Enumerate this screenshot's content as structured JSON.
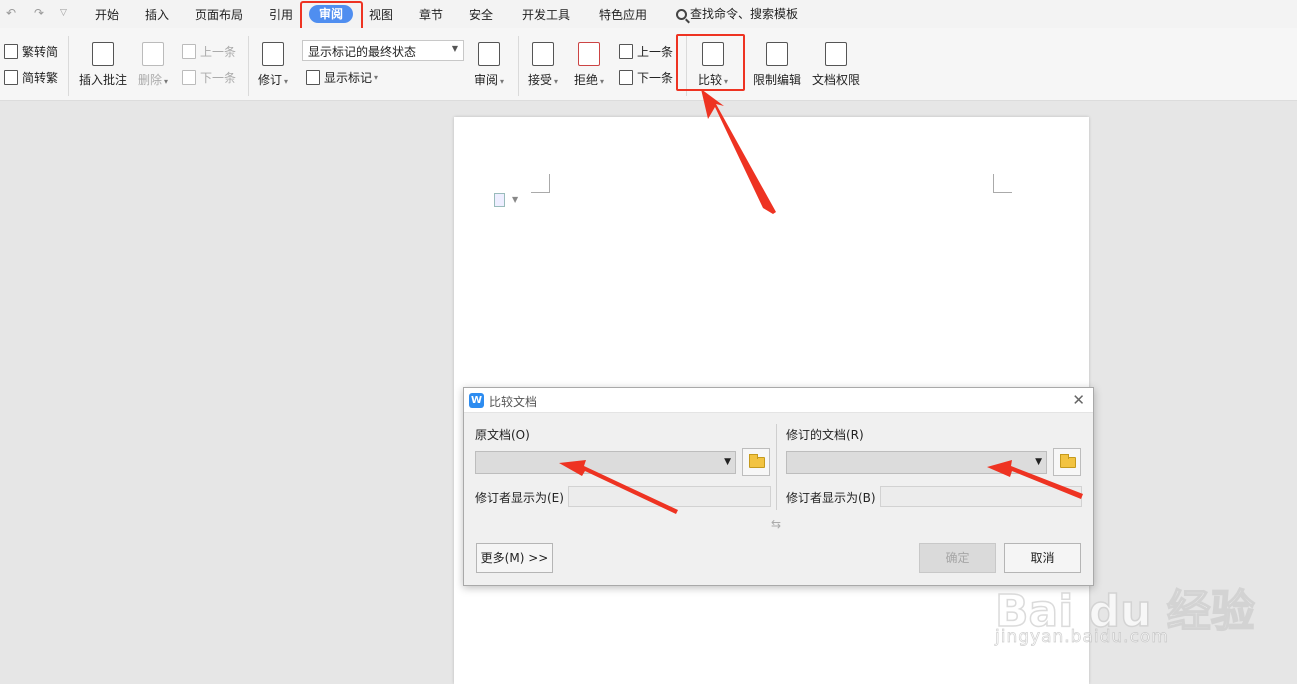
{
  "menubar": {
    "items": [
      {
        "label": "开始"
      },
      {
        "label": "插入"
      },
      {
        "label": "页面布局"
      },
      {
        "label": "引用"
      },
      {
        "label": "审阅",
        "active": true
      },
      {
        "label": "视图"
      },
      {
        "label": "章节"
      },
      {
        "label": "安全"
      },
      {
        "label": "开发工具"
      },
      {
        "label": "特色应用"
      }
    ],
    "search_label": "查找命令、搜索模板"
  },
  "ribbon": {
    "trad_to_simp": "繁转简",
    "simp_to_trad": "简转繁",
    "insert_comment": "插入批注",
    "delete": "删除",
    "prev_comment": "上一条",
    "next_comment": "下一条",
    "revise": "修订",
    "markup_mode": "显示标记的最终状态",
    "show_markup": "显示标记",
    "review": "审阅",
    "accept": "接受",
    "reject": "拒绝",
    "prev_change": "上一条",
    "next_change": "下一条",
    "compare": "比较",
    "restrict_edit": "限制编辑",
    "doc_rights": "文档权限"
  },
  "dialog": {
    "title": "比较文档",
    "original_label": "原文档(O)",
    "revised_label": "修订的文档(R)",
    "original_reviewer_label": "修订者显示为(E)",
    "revised_reviewer_label": "修订者显示为(B)",
    "more_button": "更多(M) >>",
    "ok_button": "确定",
    "cancel_button": "取消",
    "swap_glyph": "⇆"
  },
  "watermark": {
    "text": "Bai du 经验",
    "url": "jingyan.baidu.com"
  },
  "colors": {
    "accent": "#4f8ef0",
    "highlight": "#ee3322"
  }
}
